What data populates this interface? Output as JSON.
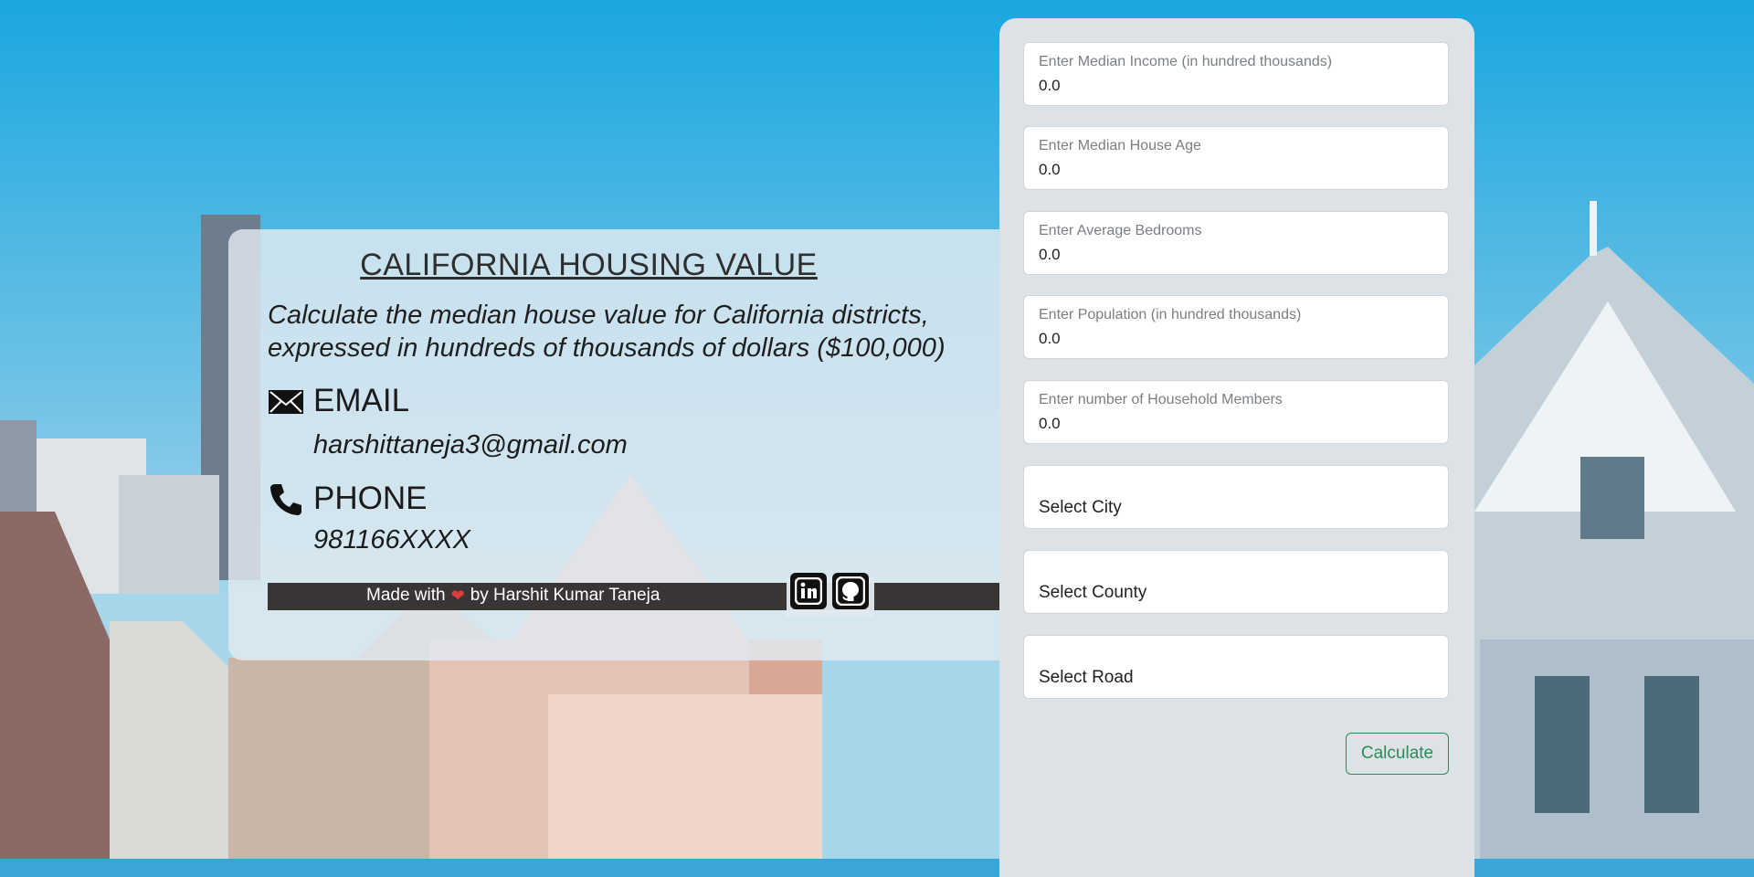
{
  "app": {
    "title": "CALIFORNIA HOUSING VALUE",
    "subtitle": "Calculate the median house value for California districts, expressed in hundreds of thousands of dollars ($100,000)"
  },
  "contact": {
    "email_label": "EMAIL",
    "email_value": "harshittaneja3@gmail.com",
    "phone_label": "PHONE",
    "phone_value": "981166XXXX",
    "email_icon": "envelope-icon",
    "phone_icon": "phone-icon"
  },
  "footer": {
    "made_with": "Made with",
    "by": "by Harshit Kumar Taneja",
    "social": [
      "linkedin-icon",
      "github-icon"
    ]
  },
  "form": {
    "fields": [
      {
        "label": "Enter Median Income (in hundred thousands)",
        "value": "0.0"
      },
      {
        "label": "Enter Median House Age",
        "value": "0.0"
      },
      {
        "label": "Enter Average Bedrooms",
        "value": "0.0"
      },
      {
        "label": "Enter Population (in hundred thousands)",
        "value": "0.0"
      },
      {
        "label": "Enter number of Household Members",
        "value": "0.0"
      }
    ],
    "selects": [
      {
        "selected": "Select City"
      },
      {
        "selected": "Select County"
      },
      {
        "selected": "Select Road"
      }
    ],
    "submit_label": "Calculate"
  },
  "colors": {
    "accent": "#2e8b57",
    "footer_bg": "#3a3535",
    "heart": "#e23b3b"
  }
}
